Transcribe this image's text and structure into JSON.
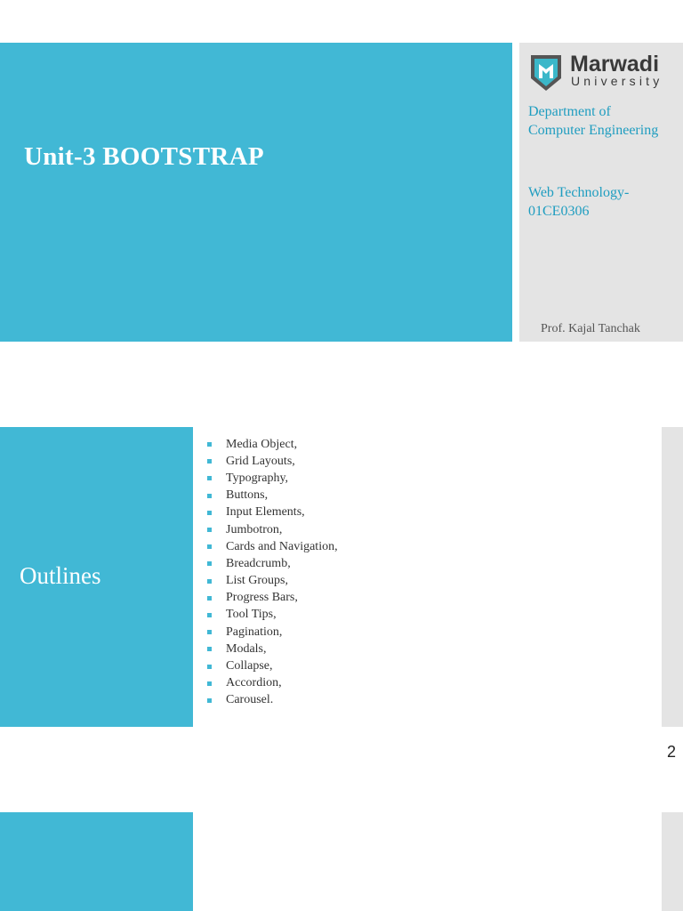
{
  "slide1": {
    "title": "Unit-3  BOOTSTRAP",
    "logo": {
      "name": "Marwadi",
      "sub": "University"
    },
    "department": [
      "Department of",
      "Computer Engineering"
    ],
    "course": [
      "Web Technology-",
      "01CE0306"
    ],
    "professor": "Prof. Kajal Tanchak"
  },
  "slide2": {
    "heading": "Outlines",
    "items": [
      "Media Object,",
      "Grid Layouts,",
      "Typography,",
      "Buttons,",
      "Input Elements,",
      "Jumbotron,",
      "Cards and Navigation,",
      "Breadcrumb,",
      "List Groups,",
      "Progress Bars,",
      "Tool Tips,",
      "Pagination,",
      "Modals,",
      "Collapse,",
      "Accordion,",
      "Carousel."
    ],
    "page_number": "2"
  },
  "colors": {
    "accent": "#41b8d5",
    "panel": "#e4e4e4"
  }
}
